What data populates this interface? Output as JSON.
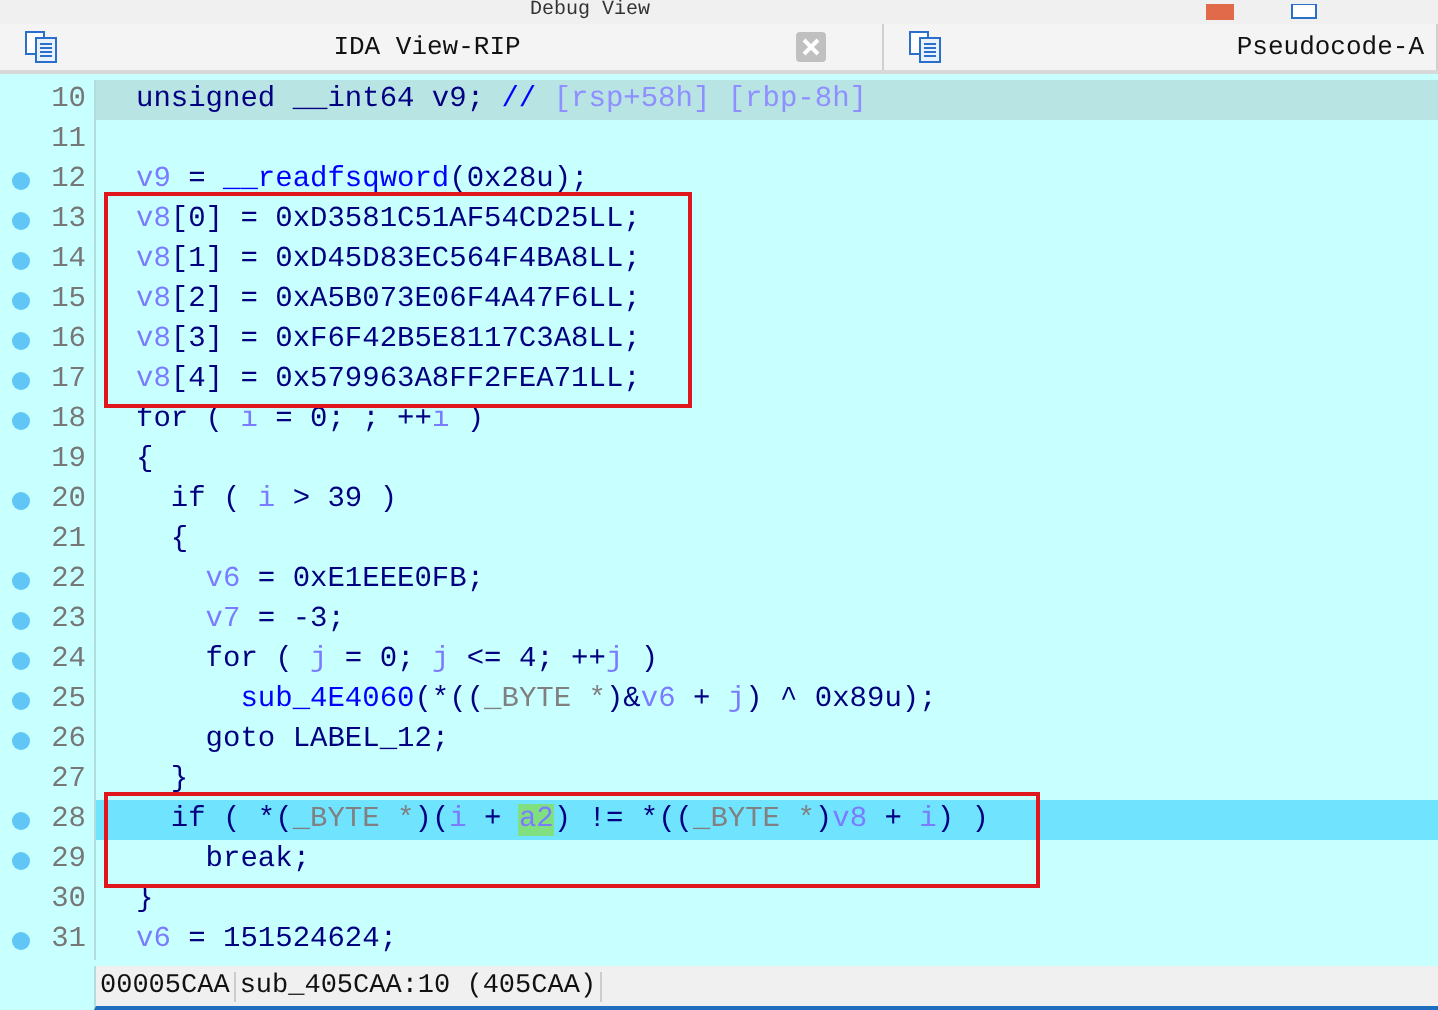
{
  "top_panel": {
    "title": "Debug View"
  },
  "tabs": [
    {
      "label": "IDA View-RIP",
      "closable": true
    },
    {
      "label": "Pseudocode-A",
      "closable": false
    }
  ],
  "lines": [
    {
      "number": "10",
      "kind": "current",
      "breakpoint": false,
      "boxed": false,
      "tokens": [
        {
          "kind": "text",
          "t": "unsigned __int64 v9; "
        },
        {
          "kind": "comment",
          "t": "//"
        },
        {
          "kind": "comment_dim",
          "t": " [rsp+58h] [rbp-8h]"
        }
      ]
    },
    {
      "number": "11",
      "kind": "plain",
      "breakpoint": false,
      "boxed": false
    },
    {
      "number": "12",
      "kind": "plain",
      "breakpoint": true,
      "boxed": false,
      "tokens": [
        {
          "kind": "var",
          "t": "v9"
        },
        {
          "kind": "text",
          "t": " = "
        },
        {
          "kind": "func",
          "t": "__readfsqword"
        },
        {
          "kind": "text",
          "t": "(0x28u);"
        }
      ]
    },
    {
      "number": "13",
      "kind": "plain",
      "breakpoint": true,
      "boxed": true,
      "tokens": [
        {
          "kind": "var",
          "t": "v8"
        },
        {
          "kind": "text",
          "t": "[0] = 0xD3581C51AF54CD25LL;"
        }
      ]
    },
    {
      "number": "14",
      "kind": "plain",
      "breakpoint": true,
      "boxed": true,
      "tokens": [
        {
          "kind": "var",
          "t": "v8"
        },
        {
          "kind": "text",
          "t": "[1] = 0xD45D83EC564F4BA8LL;"
        }
      ]
    },
    {
      "number": "15",
      "kind": "plain",
      "breakpoint": true,
      "boxed": true,
      "tokens": [
        {
          "kind": "var",
          "t": "v8"
        },
        {
          "kind": "text",
          "t": "[2] = 0xA5B073E06F4A47F6LL;"
        }
      ]
    },
    {
      "number": "16",
      "kind": "plain",
      "breakpoint": true,
      "boxed": true,
      "tokens": [
        {
          "kind": "var",
          "t": "v8"
        },
        {
          "kind": "text",
          "t": "[3] = 0xF6F42B5E8117C3A8LL;"
        }
      ]
    },
    {
      "number": "17",
      "kind": "plain",
      "breakpoint": true,
      "boxed": true,
      "tokens": [
        {
          "kind": "var",
          "t": "v8"
        },
        {
          "kind": "text",
          "t": "[4] = 0x579963A8FF2FEA71LL;"
        }
      ]
    },
    {
      "number": "18",
      "kind": "plain",
      "breakpoint": true,
      "boxed": false,
      "tokens": [
        {
          "kind": "text",
          "t": "for ( "
        },
        {
          "kind": "var",
          "t": "i"
        },
        {
          "kind": "text",
          "t": " = 0; ; ++"
        },
        {
          "kind": "var",
          "t": "i"
        },
        {
          "kind": "text",
          "t": " )"
        }
      ]
    },
    {
      "number": "19",
      "kind": "plain",
      "breakpoint": false,
      "boxed": false,
      "tokens": [
        {
          "kind": "text",
          "t": "{"
        }
      ]
    },
    {
      "number": "20",
      "kind": "plain",
      "breakpoint": true,
      "boxed": false,
      "tokens": [
        {
          "kind": "text",
          "t": "  if ( "
        },
        {
          "kind": "var",
          "t": "i"
        },
        {
          "kind": "text",
          "t": " > 39 )"
        }
      ]
    },
    {
      "number": "21",
      "kind": "plain",
      "breakpoint": false,
      "boxed": false,
      "tokens": [
        {
          "kind": "text",
          "t": "  {"
        }
      ]
    },
    {
      "number": "22",
      "kind": "plain",
      "breakpoint": true,
      "boxed": false,
      "tokens": [
        {
          "kind": "var",
          "t": "    v6"
        },
        {
          "kind": "text",
          "t": " = 0xE1EEE0FB;"
        }
      ]
    },
    {
      "number": "23",
      "kind": "plain",
      "breakpoint": true,
      "boxed": false,
      "tokens": [
        {
          "kind": "var",
          "t": "    v7"
        },
        {
          "kind": "text",
          "t": " = -3;"
        }
      ]
    },
    {
      "number": "24",
      "kind": "plain",
      "breakpoint": true,
      "boxed": false,
      "tokens": [
        {
          "kind": "text",
          "t": "    for ( "
        },
        {
          "kind": "var",
          "t": "j"
        },
        {
          "kind": "text",
          "t": " = 0; "
        },
        {
          "kind": "var",
          "t": "j"
        },
        {
          "kind": "text",
          "t": " <= 4; ++"
        },
        {
          "kind": "var",
          "t": "j"
        },
        {
          "kind": "text",
          "t": " )"
        }
      ]
    },
    {
      "number": "25",
      "kind": "plain",
      "breakpoint": true,
      "boxed": false,
      "tokens": [
        {
          "kind": "func",
          "t": "      sub_4E4060"
        },
        {
          "kind": "text",
          "t": "(*(("
        },
        {
          "kind": "cast",
          "t": "_BYTE *"
        },
        {
          "kind": "text",
          "t": ")&"
        },
        {
          "kind": "var",
          "t": "v6"
        },
        {
          "kind": "text",
          "t": " + "
        },
        {
          "kind": "var",
          "t": "j"
        },
        {
          "kind": "text",
          "t": ") ^ 0x89u);"
        }
      ]
    },
    {
      "number": "26",
      "kind": "plain",
      "breakpoint": true,
      "boxed": false,
      "tokens": [
        {
          "kind": "text",
          "t": "    goto LABEL_12;"
        }
      ]
    },
    {
      "number": "27",
      "kind": "plain",
      "breakpoint": false,
      "boxed": false,
      "tokens": [
        {
          "kind": "text",
          "t": "  }"
        }
      ]
    },
    {
      "number": "28",
      "kind": "cursor",
      "breakpoint": true,
      "boxed": true,
      "tokens": [
        {
          "kind": "text",
          "t": "  if ( *("
        },
        {
          "kind": "cast",
          "t": "_BYTE *"
        },
        {
          "kind": "text",
          "t": ")("
        },
        {
          "kind": "var",
          "t": "i"
        },
        {
          "kind": "text",
          "t": " + "
        },
        {
          "kind": "selected_var",
          "t": "a2"
        },
        {
          "kind": "text",
          "t": ") != *(("
        },
        {
          "kind": "cast",
          "t": "_BYTE *"
        },
        {
          "kind": "text",
          "t": ")"
        },
        {
          "kind": "var",
          "t": "v8"
        },
        {
          "kind": "text",
          "t": " + "
        },
        {
          "kind": "var",
          "t": "i"
        },
        {
          "kind": "text",
          "t": ") )"
        }
      ]
    },
    {
      "number": "29",
      "kind": "plain",
      "breakpoint": true,
      "boxed": true,
      "tokens": [
        {
          "kind": "text",
          "t": "    break;"
        }
      ]
    },
    {
      "number": "30",
      "kind": "plain",
      "breakpoint": false,
      "boxed": false,
      "tokens": [
        {
          "kind": "text",
          "t": "}"
        }
      ]
    },
    {
      "number": "31",
      "kind": "plain",
      "breakpoint": true,
      "boxed": false,
      "tokens": [
        {
          "kind": "var",
          "t": "v6"
        },
        {
          "kind": "text",
          "t": " = 151524624;"
        }
      ]
    }
  ],
  "status_bar": {
    "address": "00005CAA",
    "location": "sub_405CAA:10 (405CAA)"
  }
}
